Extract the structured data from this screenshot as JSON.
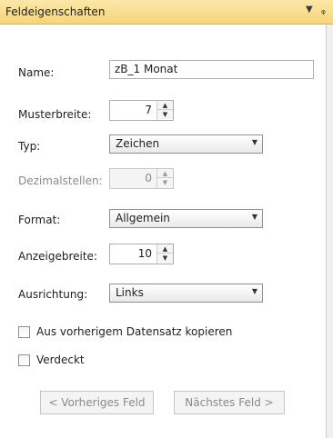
{
  "panel": {
    "title": "Feldeigenschaften",
    "dropdown_icon": "triangle-down",
    "pin_icon": "pin"
  },
  "fields": {
    "name": {
      "label": "Name:",
      "value": "zB_1 Monat"
    },
    "musterbreite": {
      "label": "Musterbreite:",
      "value": "7"
    },
    "typ": {
      "label": "Typ:",
      "value": "Zeichen"
    },
    "dezimalstellen": {
      "label": "Dezimalstellen:",
      "value": "0",
      "enabled": false
    },
    "format": {
      "label": "Format:",
      "value": "Allgemein"
    },
    "anzeigebreite": {
      "label": "Anzeigebreite:",
      "value": "10"
    },
    "ausrichtung": {
      "label": "Ausrichtung:",
      "value": "Links"
    }
  },
  "checkboxes": {
    "copy_previous": {
      "label": "Aus vorherigem Datensatz kopieren",
      "checked": false
    },
    "hidden": {
      "label": "Verdeckt",
      "checked": false
    }
  },
  "buttons": {
    "previous": "< Vorheriges Feld",
    "next": "Nächstes Feld >"
  }
}
